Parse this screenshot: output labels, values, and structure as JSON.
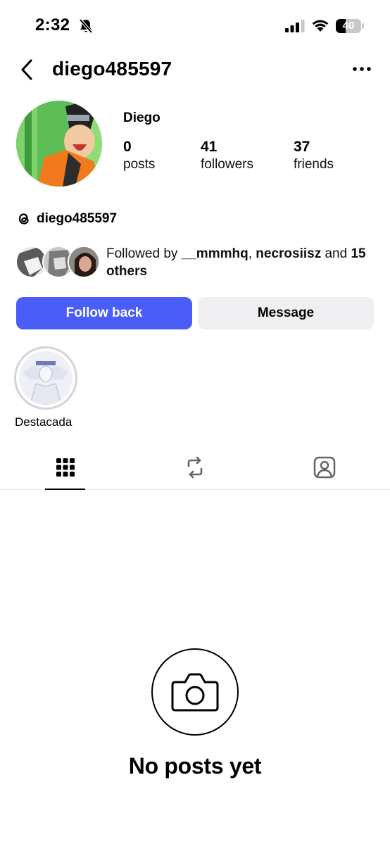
{
  "status_bar": {
    "time": "2:32",
    "battery_level": "40",
    "battery_fraction": 0.4
  },
  "nav": {
    "title": "diego485597",
    "back_icon": "chevron-left-icon",
    "more_icon": "more-horizontal-icon"
  },
  "profile": {
    "display_name": "Diego",
    "stats": [
      {
        "value": "0",
        "label": "posts"
      },
      {
        "value": "41",
        "label": "followers"
      },
      {
        "value": "37",
        "label": "friends"
      }
    ],
    "threads_handle": "diego485597",
    "followed_by": {
      "prefix": "Followed by ",
      "user1": "__mmmhq",
      "sep": ", ",
      "user2": "necrosiisz",
      "and": " and ",
      "others": "15 others"
    }
  },
  "actions": {
    "follow_back": "Follow back",
    "message": "Message"
  },
  "highlights": [
    {
      "label": "Destacada"
    }
  ],
  "tabs": [
    {
      "icon": "grid-icon",
      "active": true
    },
    {
      "icon": "repost-icon",
      "active": false
    },
    {
      "icon": "tagged-icon",
      "active": false
    }
  ],
  "empty_state": {
    "icon": "camera-icon",
    "title": "No posts yet"
  },
  "colors": {
    "primary_button": "#4a5df9",
    "secondary_button": "#efeff2"
  }
}
